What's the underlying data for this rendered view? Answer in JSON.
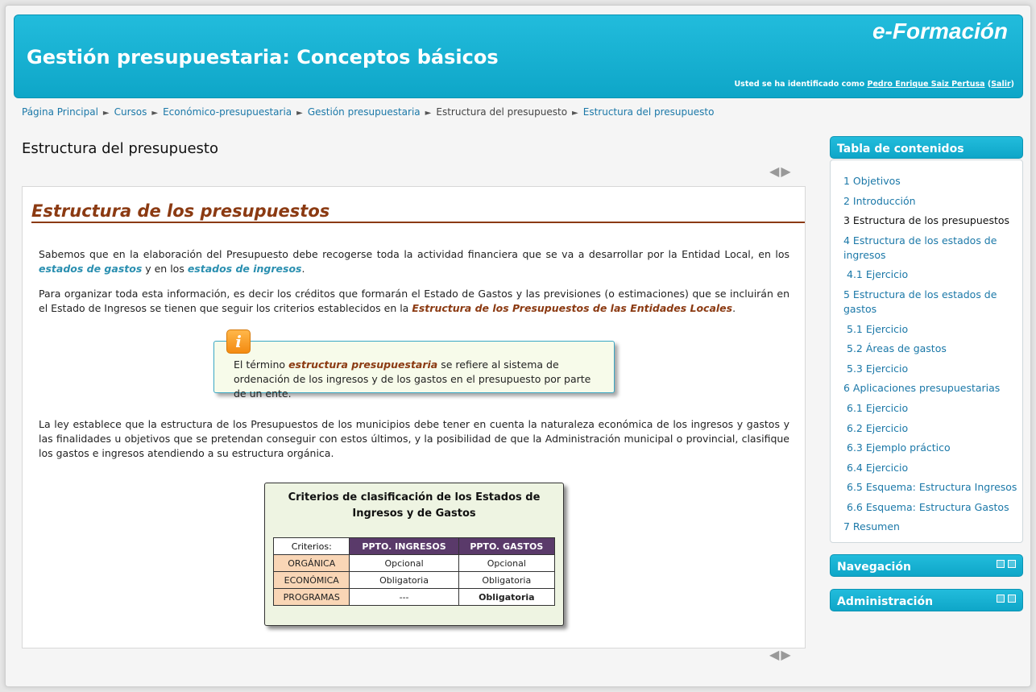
{
  "header": {
    "title": "Gestión presupuestaria: Conceptos básicos",
    "logo": "e-Formación",
    "login_prefix": "Usted se ha identificado como",
    "user": "Pedro Enrique Saiz Pertusa",
    "logout": "Salir"
  },
  "breadcrumb": [
    "Página Principal",
    "Cursos",
    "Económico-presupuestaria",
    "Gestión presupuestaria",
    "Estructura del presupuesto",
    "Estructura del presupuesto"
  ],
  "page_title": "Estructura del presupuesto",
  "nav": {
    "prev": "◀",
    "next": "▶"
  },
  "content": {
    "section_title": "Estructura de los presupuestos",
    "p1_a": "Sabemos que en la elaboración del Presupuesto debe recogerse toda la actividad financiera que se va a desarrollar por la Entidad Local, en los ",
    "p1_kw1": "estados de gastos",
    "p1_b": " y en los ",
    "p1_kw2": "estados de ingresos",
    "p1_c": ".",
    "p2_a": "Para organizar toda esta información, es decir los créditos que formarán el Estado de Gastos y las previsiones (o estimaciones) que se incluirán en el Estado de Ingresos se tienen que seguir los criterios establecidos en la ",
    "p2_kw": "Estructura de los Presupuestos de las Entidades Locales",
    "p2_b": ".",
    "info_icon": "i",
    "info_a": "El término ",
    "info_kw": "estructura presupuestaria",
    "info_b": " se refiere al sistema de ordenación de los ingresos y de los gastos en el presupuesto por parte de un ente.",
    "p3": "La ley establece que la estructura de los Presupuestos de los municipios debe tener en cuenta la naturaleza económica de los ingresos y gastos y las finalidades u objetivos que se pretendan conseguir con estos últimos, y la posibilidad de que la Administración municipal o provincial, clasifique los gastos e ingresos atendiendo a su estructura orgánica."
  },
  "criteria": {
    "title": "Criterios de clasificación de los Estados de Ingresos y de Gastos",
    "headers": [
      "Criterios:",
      "PPTO. INGRESOS",
      "PPTO. GASTOS"
    ],
    "rows": [
      [
        "ORGÁNICA",
        "Opcional",
        "Opcional"
      ],
      [
        "ECONÓMICA",
        "Obligatoria",
        "Obligatoria"
      ],
      [
        "PROGRAMAS",
        "---",
        "Obligatoria"
      ]
    ]
  },
  "sidebar": {
    "toc_title": "Tabla de contenidos",
    "toc": [
      "1 Objetivos",
      "2 Introducción",
      "3 Estructura de los presupuestos",
      "4 Estructura de los estados de ingresos",
      "4.1 Ejercicio",
      "5 Estructura de los estados de gastos",
      "5.1 Ejercicio",
      "5.2 Áreas de gastos",
      "5.3 Ejercicio",
      "6 Aplicaciones presupuestarias",
      "6.1 Ejercicio",
      "6.2 Ejercicio",
      "6.3 Ejemplo práctico",
      "6.4 Ejercicio",
      "6.5 Esquema: Estructura Ingresos",
      "6.6 Esquema: Estructura Gastos",
      "7 Resumen"
    ],
    "navigation_title": "Navegación",
    "administration_title": "Administración"
  }
}
